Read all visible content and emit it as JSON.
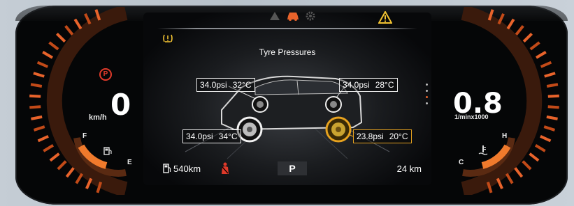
{
  "speed": {
    "value": "0",
    "unit": "km/h"
  },
  "rpm": {
    "value": "0.8",
    "unit": "1/minx1000"
  },
  "fuel_gauge": {
    "full_label": "F",
    "empty_label": "E",
    "icon": "fuel-pump-icon"
  },
  "temp_gauge": {
    "hot_label": "H",
    "cold_label": "C",
    "icon": "coolant-temperature-icon"
  },
  "top_bar": {
    "icons": [
      "warning-triangle-icon",
      "car-icon",
      "gear-settings-icon"
    ],
    "active_icon": "car-icon",
    "master_warning_icon": "master-warning-icon"
  },
  "tpms_indicator_icon": "tpms-icon",
  "parking_brake_icon": "parking-brake-icon",
  "title": "Tyre Pressures",
  "tyres": {
    "front_left": {
      "pressure": "34.0psi",
      "temp": "32°C"
    },
    "front_right": {
      "pressure": "34.0psi",
      "temp": "28°C"
    },
    "rear_left": {
      "pressure": "34.0psi",
      "temp": "34°C"
    },
    "rear_right": {
      "pressure": "23.8psi",
      "temp": "20°C",
      "alert": true
    }
  },
  "bottom_bar": {
    "range": "540km",
    "gear": "P",
    "trip": "24 km",
    "seatbelt_icon": "seatbelt-warning-icon"
  },
  "colors": {
    "accent_orange": "#e8632b",
    "alert_amber": "#e6a21f",
    "warning_red": "#e03a2a"
  }
}
